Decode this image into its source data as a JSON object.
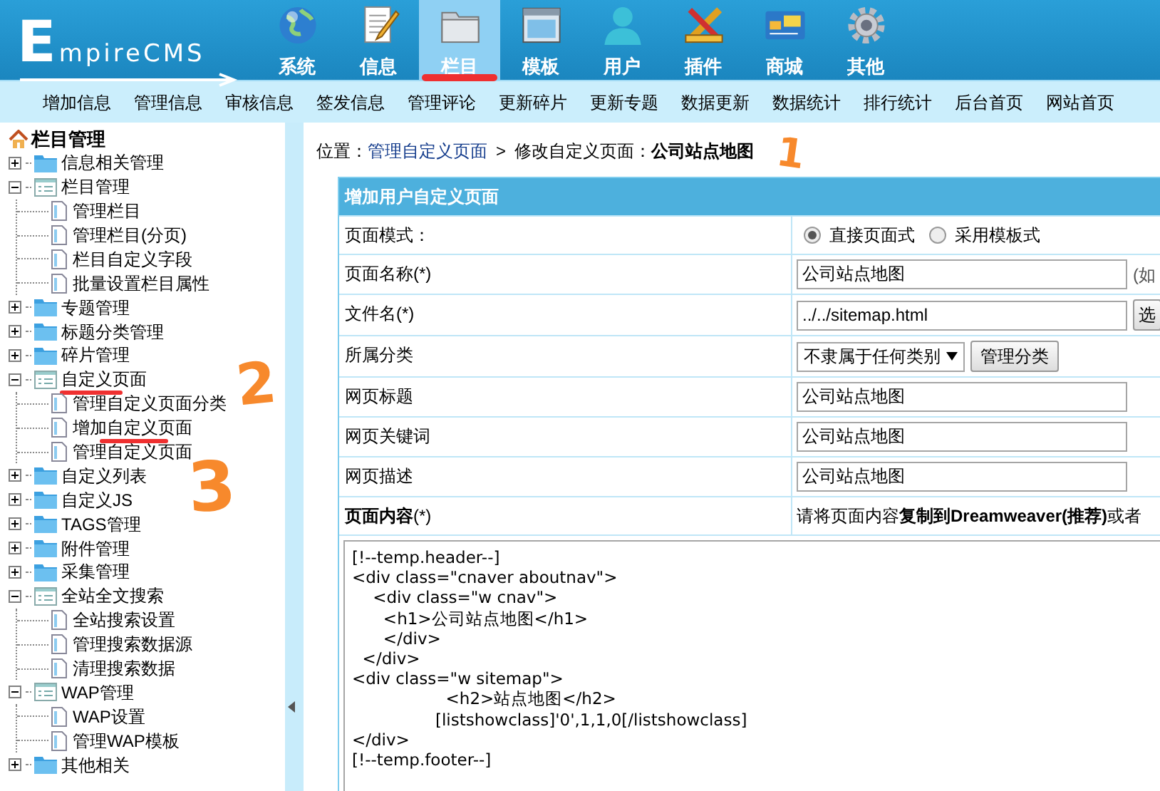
{
  "logo": {
    "text": "EmpireCMS"
  },
  "top_nav": [
    {
      "label": "系统",
      "selected": false
    },
    {
      "label": "信息",
      "selected": false
    },
    {
      "label": "栏目",
      "selected": true
    },
    {
      "label": "模板",
      "selected": false
    },
    {
      "label": "用户",
      "selected": false
    },
    {
      "label": "插件",
      "selected": false
    },
    {
      "label": "商城",
      "selected": false
    },
    {
      "label": "其他",
      "selected": false
    }
  ],
  "sub_nav": [
    "增加信息",
    "管理信息",
    "审核信息",
    "签发信息",
    "管理评论",
    "更新碎片",
    "更新专题",
    "数据更新",
    "数据统计",
    "排行统计",
    "后台首页",
    "网站首页"
  ],
  "sidebar": {
    "title": "栏目管理",
    "items": [
      {
        "label": "信息相关管理",
        "expanded": false
      },
      {
        "label": "栏目管理",
        "expanded": true,
        "children": [
          {
            "label": "管理栏目"
          },
          {
            "label": "管理栏目(分页)"
          },
          {
            "label": "栏目自定义字段"
          },
          {
            "label": "批量设置栏目属性"
          }
        ]
      },
      {
        "label": "专题管理",
        "expanded": false
      },
      {
        "label": "标题分类管理",
        "expanded": false
      },
      {
        "label": "碎片管理",
        "expanded": false
      },
      {
        "label": "自定义页面",
        "expanded": true,
        "children": [
          {
            "label": "管理自定义页面分类"
          },
          {
            "label": "增加自定义页面"
          },
          {
            "label": "管理自定义页面"
          }
        ]
      },
      {
        "label": "自定义列表",
        "expanded": false
      },
      {
        "label": "自定义JS",
        "expanded": false
      },
      {
        "label": "TAGS管理",
        "expanded": false
      },
      {
        "label": "附件管理",
        "expanded": false
      },
      {
        "label": "采集管理",
        "expanded": false
      },
      {
        "label": "全站全文搜索",
        "expanded": true,
        "children": [
          {
            "label": "全站搜索设置"
          },
          {
            "label": "管理搜索数据源"
          },
          {
            "label": "清理搜索数据"
          }
        ]
      },
      {
        "label": "WAP管理",
        "expanded": true,
        "children": [
          {
            "label": "WAP设置"
          },
          {
            "label": "管理WAP模板"
          }
        ]
      },
      {
        "label": "其他相关",
        "expanded": false
      }
    ]
  },
  "breadcrumb": {
    "prefix": "位置：",
    "link": "管理自定义页面",
    "separator": ">",
    "current_label": "修改自定义页面：",
    "current": "公司站点地图"
  },
  "form": {
    "title": "增加用户自定义页面",
    "rows": [
      {
        "kind": "radio",
        "label": "页面模式：",
        "options": [
          {
            "label": "直接页面式",
            "selected": true
          },
          {
            "label": "采用模板式",
            "selected": false
          }
        ]
      },
      {
        "kind": "text",
        "label": "页面名称(*)",
        "value": "公司站点地图",
        "note": "(如"
      },
      {
        "kind": "text",
        "label": "文件名(*)",
        "value": "../../sitemap.html",
        "button": "选"
      },
      {
        "kind": "select",
        "label": "所属分类",
        "value": "不隶属于任何类别",
        "button": "管理分类"
      },
      {
        "kind": "text",
        "label": "网页标题",
        "value": "公司站点地图"
      },
      {
        "kind": "text",
        "label": "网页关键词",
        "value": "公司站点地图"
      },
      {
        "kind": "text",
        "label": "网页描述",
        "value": "公司站点地图"
      },
      {
        "kind": "note",
        "label": "**页面内容**(*)",
        "text": "请将页面内容**复制到Dreamweaver(推荐)**或者"
      }
    ],
    "content": "[!--temp.header--]\n<div class=\"cnaver aboutnav\">\n    <div class=\"w cnav\">\n      <h1>公司站点地图</h1>\n      </div>\n  </div>\n<div class=\"w sitemap\">\n                  <h2>站点地图</h2>\n                [listshowclass]'0',1,1,0[/listshowclass]\n</div>\n[!--temp.footer--]"
  },
  "annotations": [
    {
      "text": "1"
    },
    {
      "text": "2"
    },
    {
      "text": "3"
    }
  ]
}
